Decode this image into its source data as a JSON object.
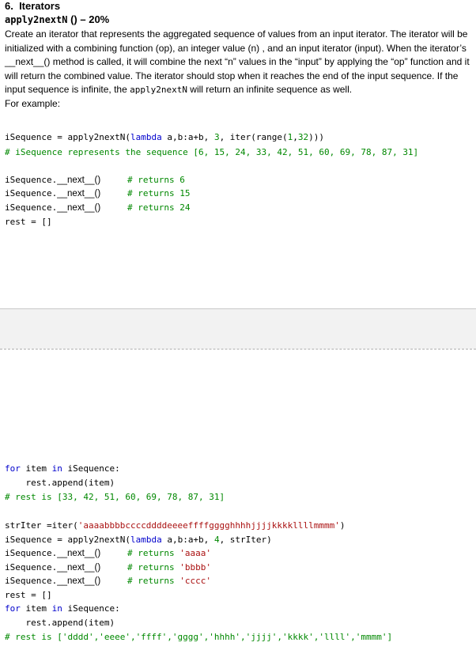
{
  "heading": {
    "title": "6.  Iterators",
    "func_name": "apply2nextN",
    "func_suffix": " () – 20%"
  },
  "description": {
    "p1": "Create an iterator that represents the aggregated sequence of values from an input iterator. The iterator will be initialized with a combining function (op), an integer value (n) , and an input iterator (input). When the iterator’s __next__() method is called, it will combine the next “n” values in the “input” by applying the “op” function and it will return the combined value. The iterator should stop when it reaches the end of the input sequence. If the input sequence is infinite, the ",
    "p1_code": "apply2nextN",
    "p1_end": " will return an infinite sequence as well.",
    "p2": "For example:"
  },
  "example1": {
    "line1_a": "iSequence = apply2nextN(",
    "line1_kw": "lambda",
    "line1_b": " a,b:a+b, ",
    "line1_n": "3",
    "line1_c": ", iter(range(",
    "line1_n2": "1",
    "line1_d": ",",
    "line1_n3": "32",
    "line1_e": ")))",
    "line2": "# iSequence represents the sequence [6, 15, 24, 33, 42, 51, 60, 69, 78, 87, 31]",
    "calls": [
      {
        "call": "iSequence.",
        "dunder": "__next__()",
        "comment": "# returns 6"
      },
      {
        "call": "iSequence.",
        "dunder": "__next__()",
        "comment": "# returns 15"
      },
      {
        "call": "iSequence.",
        "dunder": "__next__()",
        "comment": "# returns 24"
      }
    ],
    "rest": "rest = []"
  },
  "example2": {
    "for_kw": "for",
    "for_mid": " item ",
    "in_kw": "in",
    "for_end": " iSequence:",
    "append": "    rest.append(item)",
    "result": "# rest is [33, 42, 51, 60, 69, 78, 87, 31]"
  },
  "example3": {
    "str_a": "strIter =iter(",
    "str_lit": "'aaaabbbbccccddddeeeeffffgggghhhhjjjjkkkkllllmmmm'",
    "str_b": ")",
    "seq_a": "iSequence = apply2nextN(",
    "seq_kw": "lambda",
    "seq_b": " a,b:a+b, ",
    "seq_n": "4",
    "seq_c": ", strIter)",
    "calls": [
      {
        "call": "iSequence.",
        "dunder": "__next__()",
        "comment": "# returns ",
        "lit": "'aaaa'"
      },
      {
        "call": "iSequence.",
        "dunder": "__next__()",
        "comment": "# returns ",
        "lit": "'bbbb'"
      },
      {
        "call": "iSequence.",
        "dunder": "__next__()",
        "comment": "# returns ",
        "lit": "'cccc'"
      }
    ],
    "rest": "rest = []",
    "for_kw": "for",
    "for_mid": " item ",
    "in_kw": "in",
    "for_end": " iSequence:",
    "append": "    rest.append(item)",
    "result": "# rest is ['dddd','eeee','ffff','gggg','hhhh','jjjj','kkkk','llll','mmmm']"
  }
}
